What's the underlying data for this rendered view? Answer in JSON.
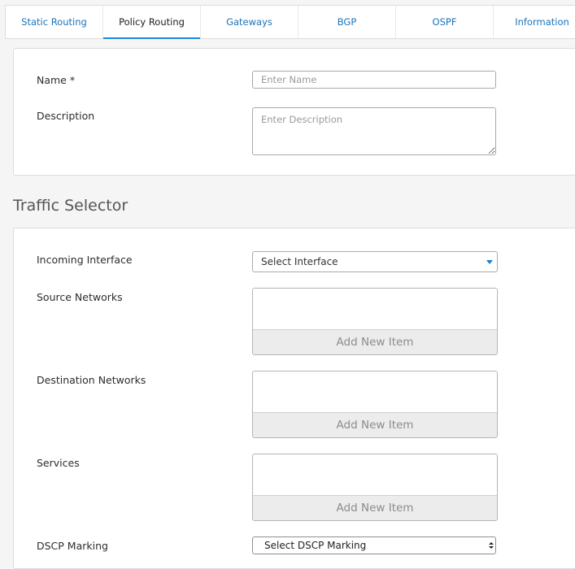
{
  "tabs": [
    {
      "label": "Static Routing"
    },
    {
      "label": "Policy Routing"
    },
    {
      "label": "Gateways"
    },
    {
      "label": "BGP"
    },
    {
      "label": "OSPF"
    },
    {
      "label": "Information"
    }
  ],
  "general": {
    "name_label": "Name *",
    "name_placeholder": "Enter Name",
    "description_label": "Description",
    "description_placeholder": "Enter Description"
  },
  "traffic_selector": {
    "title": "Traffic Selector",
    "incoming_interface_label": "Incoming Interface",
    "incoming_interface_value": "Select Interface",
    "source_networks_label": "Source Networks",
    "destination_networks_label": "Destination Networks",
    "services_label": "Services",
    "add_new_item": "Add New Item",
    "dscp_label": "DSCP Marking",
    "dscp_value": "Select DSCP Marking"
  },
  "colors": {
    "accent": "#1f8ad6",
    "tab_link": "#1a73b8"
  }
}
